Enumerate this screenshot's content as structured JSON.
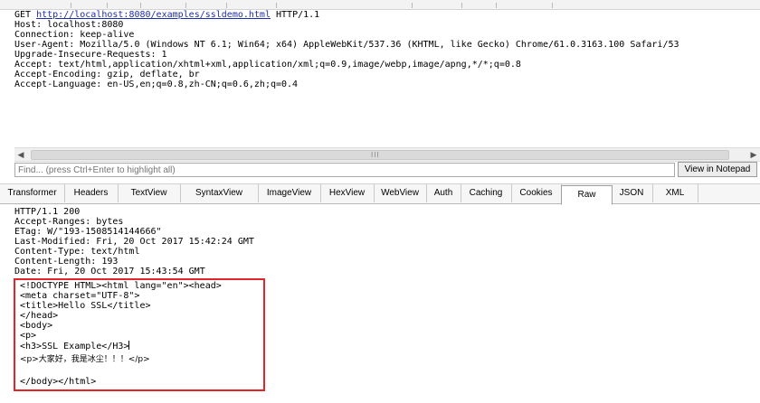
{
  "request": {
    "method": "GET",
    "url": "http://localhost:8080/examples/ssldemo.html",
    "protocol": "HTTP/1.1",
    "headers": [
      "Host: localhost:8080",
      "Connection: keep-alive",
      "User-Agent: Mozilla/5.0 (Windows NT 6.1; Win64; x64) AppleWebKit/537.36 (KHTML, like Gecko) Chrome/61.0.3163.100 Safari/53",
      "Upgrade-Insecure-Requests: 1",
      "Accept: text/html,application/xhtml+xml,application/xml;q=0.9,image/webp,image/apng,*/*;q=0.8",
      "Accept-Encoding: gzip, deflate, br",
      "Accept-Language: en-US,en;q=0.8,zh-CN;q=0.6,zh;q=0.4"
    ]
  },
  "scrollbar": {
    "left_arrow": "◀",
    "right_arrow": "▶",
    "grip": "III"
  },
  "find": {
    "placeholder": "Find... (press Ctrl+Enter to highlight all)",
    "notepad_label": "View in Notepad"
  },
  "tabs": [
    {
      "label": "Transformer",
      "active": false
    },
    {
      "label": "Headers",
      "active": false
    },
    {
      "label": "TextView",
      "active": false
    },
    {
      "label": "SyntaxView",
      "active": false
    },
    {
      "label": "ImageView",
      "active": false
    },
    {
      "label": "HexView",
      "active": false
    },
    {
      "label": "WebView",
      "active": false
    },
    {
      "label": "Auth",
      "active": false
    },
    {
      "label": "Caching",
      "active": false
    },
    {
      "label": "Cookies",
      "active": false
    },
    {
      "label": "Raw",
      "active": true
    },
    {
      "label": "JSON",
      "active": false
    },
    {
      "label": "XML",
      "active": false
    }
  ],
  "response": {
    "headers": [
      "HTTP/1.1 200",
      "Accept-Ranges: bytes",
      "ETag: W/\"193-1508514144666\"",
      "Last-Modified: Fri, 20 Oct 2017 15:42:24 GMT",
      "Content-Type: text/html",
      "Content-Length: 193",
      "Date: Fri, 20 Oct 2017 15:43:54 GMT"
    ],
    "body": [
      "<!DOCTYPE HTML><html lang=\"en\"><head>",
      "<meta charset=\"UTF-8\">",
      "<title>Hello SSL</title>",
      "</head>",
      "<body>",
      "<p>",
      "<h3>SSL Example</H3>",
      "<p>大家好，我是冰尘！！！</p>",
      "",
      "</body></html>"
    ]
  },
  "colors": {
    "highlight_border": "#e3242b",
    "link": "#1f2ea8"
  }
}
